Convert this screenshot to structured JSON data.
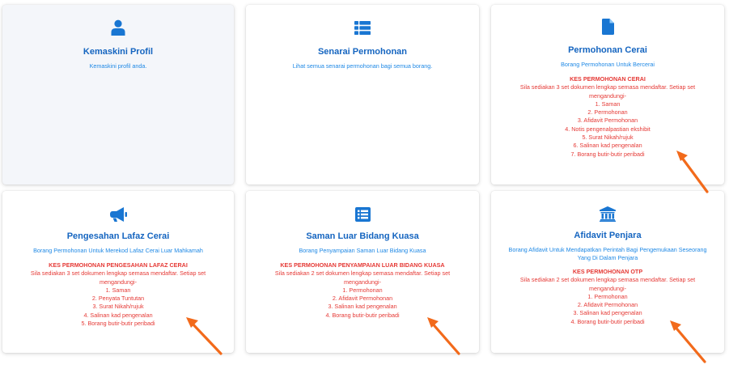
{
  "cards": [
    {
      "title": "Kemaskini Profil",
      "subtitle": "Kemaskini profil anda.",
      "icon": "user-icon"
    },
    {
      "title": "Senarai Permohonan",
      "subtitle": "Lihat semua senarai permohonan bagi semua borang.",
      "icon": "list-icon"
    },
    {
      "title": "Permohonan Cerai",
      "subtitle": "Borang Permohonan Untuk Bercerai",
      "icon": "document-icon",
      "req_heading": "KES PERMOHONAN CERAI",
      "req_intro": "Sila sediakan 3 set dokumen lengkap semasa mendaftar. Setiap set mengandungi-",
      "items": [
        "1. Saman",
        "2. Permohonan",
        "3. Afidavit Permohonan",
        "4. Notis pengenalpastian ekshibit",
        "5. Surat Nikah/rujuk",
        "6. Salinan kad pengenalan",
        "7. Borang butir-butir peribadi"
      ]
    },
    {
      "title": "Pengesahan Lafaz Cerai",
      "subtitle": "Borang Permohonan Untuk Merekod Lafaz Cerai Luar Mahkamah",
      "icon": "megaphone-icon",
      "req_heading": "KES PERMOHONAN PENGESAHAN LAFAZ CERAI",
      "req_intro": "Sila sediakan 3 set dokumen lengkap semasa mendaftar. Setiap set mengandungi-",
      "items": [
        "1. Saman",
        "2. Penyata Tuntutan",
        "3. Surat Nikah/rujuk",
        "4. Salinan kad pengenalan",
        "5. Borang butir-butir peribadi"
      ]
    },
    {
      "title": "Saman Luar Bidang Kuasa",
      "subtitle": "Borang Penyampaian Saman Luar Bidang Kuasa",
      "icon": "list-alt-icon",
      "req_heading": "KES PERMOHONAN PENYAMPAIAN LUAR BIDANG KUASA",
      "req_intro": "Sila sediakan 2 set dokumen lengkap semasa mendaftar. Setiap set mengandungi-",
      "items": [
        "1. Permohonan",
        "2. Afidavit Permohonan",
        "3. Salinan kad pengenalan",
        "4. Borang butir-butir peribadi"
      ]
    },
    {
      "title": "Afidavit Penjara",
      "subtitle": "Borang Afidavit Untuk Mendapatkan Perintah Bagi Pengemukaan Seseorang Yang Di Dalam Penjara",
      "icon": "institution-icon",
      "req_heading": "KES PERMOHONAN OTP",
      "req_intro": "Sila sediakan 2 set dokumen lengkap semasa mendaftar. Setiap set mengandungi-",
      "items": [
        "1. Permohonan",
        "2. Afidavit Permohonan",
        "3. Salinan kad pengenalan",
        "4. Borang butir-butir peribadi"
      ]
    }
  ],
  "colors": {
    "icon_blue": "#1976d2",
    "title_blue": "#1565c0",
    "subtitle_blue": "#1e88e5",
    "requirement_red": "#e53935",
    "arrow_orange": "#f26a1b"
  }
}
